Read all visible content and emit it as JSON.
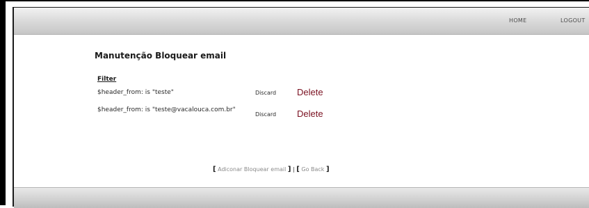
{
  "nav": {
    "home": "HOME",
    "logout": "LOGOUT"
  },
  "page": {
    "title": "Manutenção Bloquear email"
  },
  "table": {
    "header": "Filter",
    "rows": [
      {
        "filter": "$header_from: is \"teste\"",
        "discard": "Discard",
        "delete": "Delete"
      },
      {
        "filter": "$header_from: is \"teste@vacalouca.com.br\"",
        "discard": "Discard",
        "delete": "Delete"
      }
    ]
  },
  "footer": {
    "open_bracket": "[",
    "close_bracket": "]",
    "separator": "|",
    "add_link": "Adiconar Bloquear email",
    "back_link": "Go Back"
  },
  "colors": {
    "delete": "#7a1020",
    "bar": "#d0d0d0"
  }
}
